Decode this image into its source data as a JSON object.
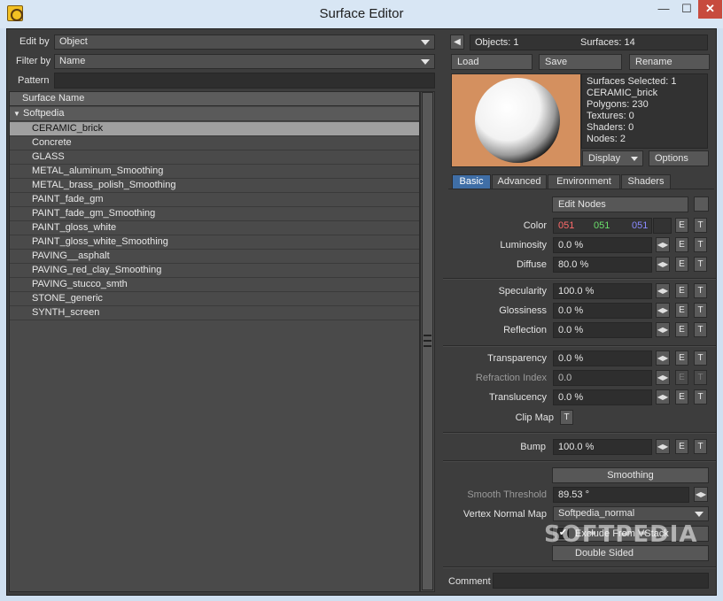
{
  "window": {
    "title": "Surface Editor",
    "min": "—",
    "max": "☐",
    "close": "✕"
  },
  "left": {
    "edit_by_label": "Edit by",
    "edit_by_value": "Object",
    "filter_by_label": "Filter by",
    "filter_by_value": "Name",
    "pattern_label": "Pattern",
    "pattern_value": "",
    "list_header": "Surface Name",
    "group": "Softpedia",
    "group_arrow": "▼",
    "surfaces": [
      "CERAMIC_brick",
      "Concrete",
      "GLASS",
      "METAL_aluminum_Smoothing",
      "METAL_brass_polish_Smoothing",
      "PAINT_fade_gm",
      "PAINT_fade_gm_Smoothing",
      "PAINT_gloss_white",
      "PAINT_gloss_white_Smoothing",
      "PAVING__asphalt",
      "PAVING_red_clay_Smoothing",
      "PAVING_stucco_smth",
      "STONE_generic",
      "SYNTH_screen"
    ],
    "selected_index": 0
  },
  "right": {
    "back_arrow": "◀",
    "objects": "Objects: 1",
    "surfaces_count": "Surfaces: 14",
    "load": "Load",
    "save": "Save",
    "rename": "Rename",
    "info": [
      "Surfaces Selected: 1",
      "CERAMIC_brick",
      "Polygons: 230",
      "Textures: 0",
      "Shaders: 0",
      "Nodes: 2"
    ],
    "display": "Display",
    "options": "Options",
    "tabs": [
      "Basic",
      "Advanced",
      "Environment",
      "Shaders"
    ],
    "edit_nodes": "Edit Nodes",
    "color_label": "Color",
    "color_r": "051",
    "color_g": "051",
    "color_b": "051",
    "colors": {
      "r": "#ff6b6b",
      "g": "#6bdf6b",
      "b": "#8a8aff",
      "swatch": "#333333",
      "tab_active": "#3f6ea6"
    },
    "props1": [
      {
        "label": "Luminosity",
        "value": "0.0 %"
      },
      {
        "label": "Diffuse",
        "value": "80.0 %"
      }
    ],
    "props2": [
      {
        "label": "Specularity",
        "value": "100.0 %"
      },
      {
        "label": "Glossiness",
        "value": "0.0 %"
      },
      {
        "label": "Reflection",
        "value": "0.0 %"
      }
    ],
    "props3": [
      {
        "label": "Transparency",
        "value": "0.0 %"
      },
      {
        "label": "Refraction Index",
        "value": "0.0"
      },
      {
        "label": "Translucency",
        "value": "0.0 %"
      }
    ],
    "clip_map": "Clip Map",
    "bump_label": "Bump",
    "bump_value": "100.0 %",
    "smoothing": "Smoothing",
    "smooth_threshold_label": "Smooth Threshold",
    "smooth_threshold_value": "89.53 °",
    "vertex_normal_label": "Vertex Normal Map",
    "vertex_normal_value": "Softpedia_normal",
    "exclude_vstack": "Exclude From VStack",
    "double_sided": "Double Sided",
    "comment_label": "Comment",
    "comment_value": "",
    "e": "E",
    "t": "T",
    "spin": "◀▶",
    "check": "✔",
    "watermark": "SOFTPEDIA"
  }
}
